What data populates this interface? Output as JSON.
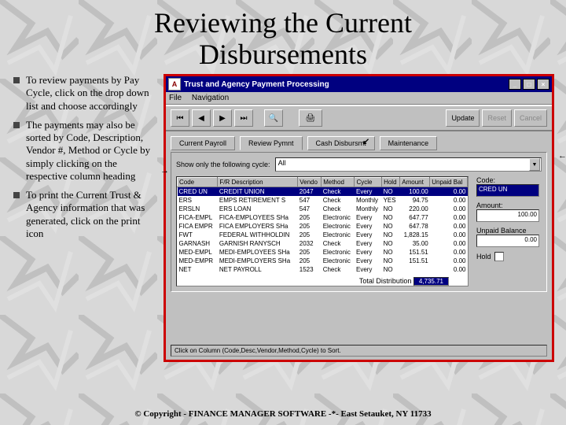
{
  "title_line1": "Reviewing the Current",
  "title_line2": "Disbursements",
  "bullets": [
    "To review payments by Pay Cycle, click on the drop down list and choose accordingly",
    "The payments may also be sorted by Code, Description, Vendor #, Method or Cycle by simply clicking on the respective column heading",
    "To print the Current Trust & Agency information that was generated, click on the print icon"
  ],
  "window": {
    "title": "Trust and Agency Payment Processing",
    "menu": {
      "file": "File",
      "nav": "Navigation"
    },
    "toolbar": {
      "update": "Update",
      "reset": "Reset",
      "cancel": "Cancel"
    },
    "tabs": {
      "a": "Current Payroll",
      "b": "Review Pymnt",
      "c": "Cash Disbursmt",
      "d": "Maintenance"
    },
    "cycle_label": "Show only the following cycle:",
    "cycle_value": "All",
    "columns": {
      "code": "Code",
      "desc": "F/R Description",
      "vendor": "Vendo",
      "method": "Method",
      "cycle": "Cycle",
      "hold": "Hold",
      "amount": "Amount",
      "unpaid": "Unpaid Bal"
    },
    "rows": [
      {
        "code": "CRED UN",
        "desc": "CREDIT UNION",
        "vendor": "2047",
        "method": "Check",
        "cycle": "Every",
        "hold": "NO",
        "amount": "100.00",
        "unpaid": "0.00",
        "sel": true
      },
      {
        "code": "ERS",
        "desc": "EMPS RETIREMENT S",
        "vendor": "547",
        "method": "Check",
        "cycle": "Monthly",
        "hold": "YES",
        "amount": "94.75",
        "unpaid": "0.00"
      },
      {
        "code": "ERSLN",
        "desc": "ERS LOAN",
        "vendor": "547",
        "method": "Check",
        "cycle": "Monthly",
        "hold": "NO",
        "amount": "220.00",
        "unpaid": "0.00"
      },
      {
        "code": "FICA-EMPL",
        "desc": "FICA-EMPLOYEES SHa",
        "vendor": "205",
        "method": "Electronic",
        "cycle": "Every",
        "hold": "NO",
        "amount": "647.77",
        "unpaid": "0.00"
      },
      {
        "code": "FICA EMPR",
        "desc": "FICA EMPLOYERS SHa",
        "vendor": "205",
        "method": "Electronic",
        "cycle": "Every",
        "hold": "NO",
        "amount": "647.78",
        "unpaid": "0.00"
      },
      {
        "code": "FWT",
        "desc": "FEDERAL WITHHOLDIN",
        "vendor": "205",
        "method": "Electronic",
        "cycle": "Every",
        "hold": "NO",
        "amount": "1,828.15",
        "unpaid": "0.00"
      },
      {
        "code": "GARNASH",
        "desc": "GARNISH RANYSCH",
        "vendor": "2032",
        "method": "Check",
        "cycle": "Every",
        "hold": "NO",
        "amount": "35.00",
        "unpaid": "0.00"
      },
      {
        "code": "MED-EMPL",
        "desc": "MEDI-EMPLOYEES SHa",
        "vendor": "205",
        "method": "Electronic",
        "cycle": "Every",
        "hold": "NO",
        "amount": "151.51",
        "unpaid": "0.00"
      },
      {
        "code": "MED-EMPR",
        "desc": "MEDI-EMPLOYERS SHa",
        "vendor": "205",
        "method": "Electronic",
        "cycle": "Every",
        "hold": "NO",
        "amount": "151.51",
        "unpaid": "0.00"
      },
      {
        "code": "NET",
        "desc": "NET PAYROLL",
        "vendor": "1523",
        "method": "Check",
        "cycle": "Every",
        "hold": "NO",
        "amount": "",
        "unpaid": "0.00"
      }
    ],
    "total_label": "Total Distribution",
    "total_value": "4,735.71",
    "side": {
      "code_lbl": "Code:",
      "code_val": "CRED UN",
      "amt_lbl": "Amount:",
      "amt_val": "100.00",
      "unpaid_lbl": "Unpaid Balance",
      "unpaid_val": "0.00",
      "hold_lbl": "Hold"
    },
    "status": "Click on Column (Code,Desc,Vendor,Method,Cycle) to Sort."
  },
  "copyright": "© Copyright - FINANCE MANAGER SOFTWARE -*- East Setauket, NY 11733"
}
